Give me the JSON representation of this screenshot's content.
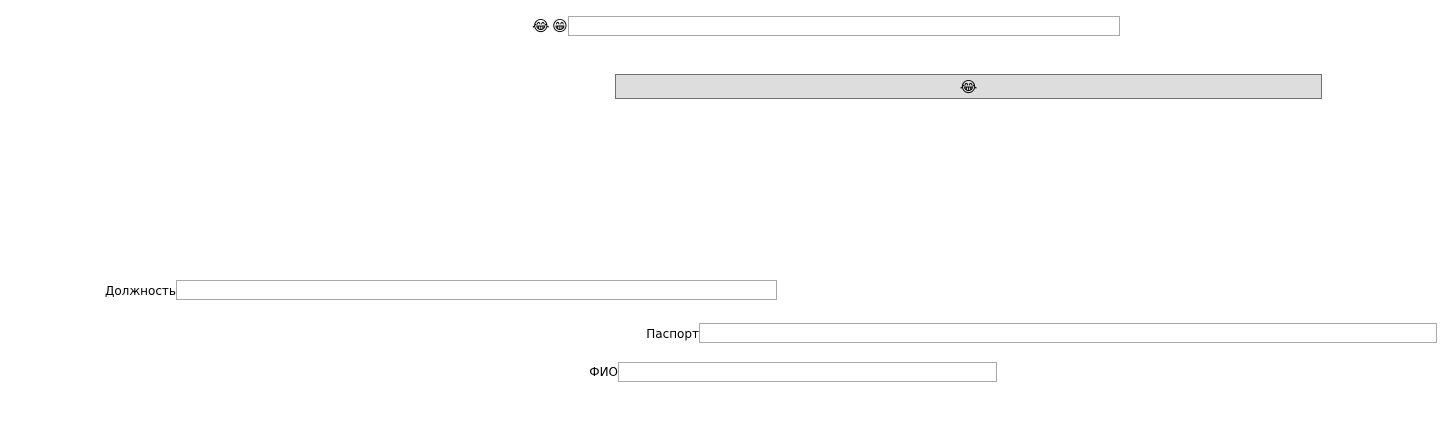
{
  "top_row": {
    "label_icon_1": "😂",
    "label_icon_2": "😁",
    "input_value": ""
  },
  "action_button": {
    "label": "😂"
  },
  "fields": {
    "position": {
      "label": "Должность",
      "value": ""
    },
    "passport": {
      "label": "Паспорт",
      "value": ""
    },
    "full_name": {
      "label": "ФИО",
      "value": ""
    }
  }
}
